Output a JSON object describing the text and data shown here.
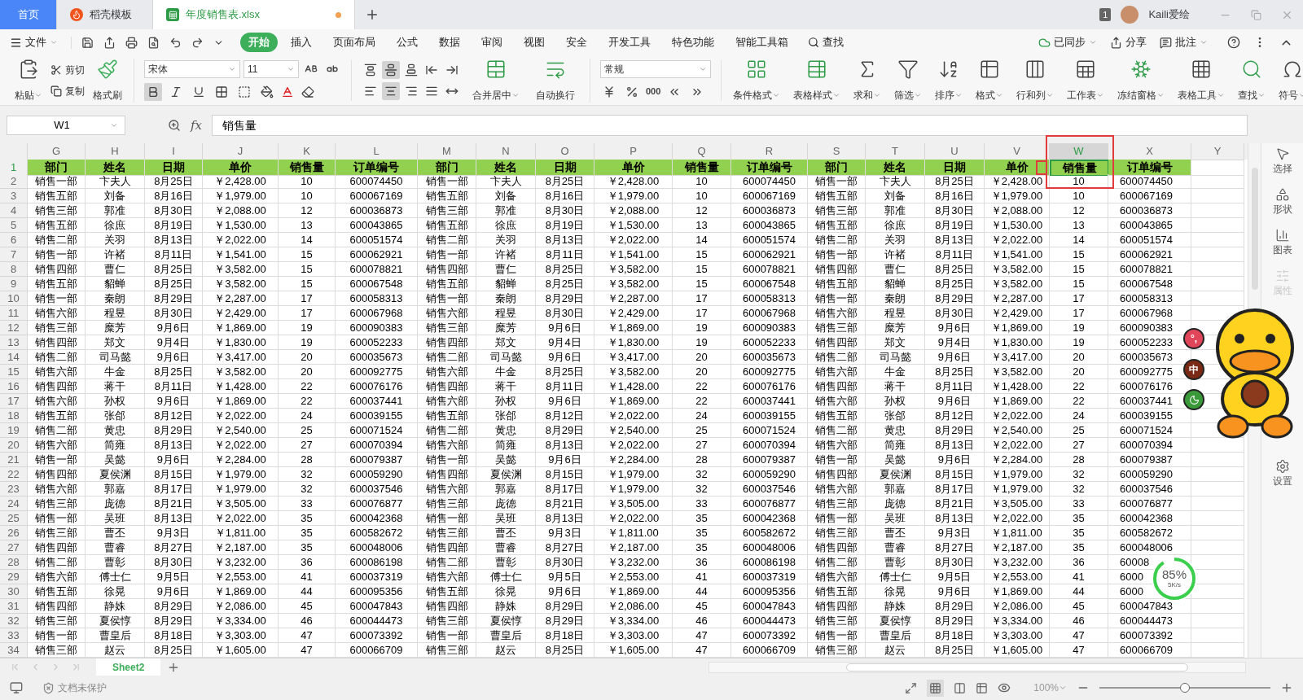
{
  "tabs": [
    {
      "label": "首页",
      "selected": false,
      "kind": "home"
    },
    {
      "label": "稻壳模板",
      "selected": false,
      "kind": "docer"
    },
    {
      "label": "年度销售表.xlsx",
      "selected": true,
      "kind": "sheet",
      "unsaved": true
    }
  ],
  "account": {
    "badge": "1",
    "user": "Kaili爱绘"
  },
  "menu": {
    "file": "文件",
    "tabs": [
      {
        "label": "开始",
        "selected": true
      },
      {
        "label": "插入",
        "selected": false
      },
      {
        "label": "页面布局",
        "selected": false
      },
      {
        "label": "公式",
        "selected": false
      },
      {
        "label": "数据",
        "selected": false
      },
      {
        "label": "审阅",
        "selected": false
      },
      {
        "label": "视图",
        "selected": false
      },
      {
        "label": "安全",
        "selected": false
      },
      {
        "label": "开发工具",
        "selected": false
      },
      {
        "label": "特色功能",
        "selected": false
      },
      {
        "label": "智能工具箱",
        "selected": false
      }
    ],
    "search": "查找",
    "actions": [
      "已同步",
      "分享",
      "批注"
    ]
  },
  "ribbon": {
    "clipboard": [
      "粘贴",
      "剪切",
      "复制",
      "格式刷"
    ],
    "font": {
      "name": "宋体",
      "size": "11",
      "styles": [
        {
          "selected": true
        },
        {
          "selected": false
        },
        {
          "selected": false
        }
      ]
    },
    "align_top": [
      {
        "selected": false
      },
      {
        "selected": true
      },
      {
        "selected": false
      },
      {
        "selected": false
      },
      {
        "selected": false
      }
    ],
    "align_bottom": [
      {
        "selected": false
      },
      {
        "selected": true
      },
      {
        "selected": false
      },
      {
        "selected": false
      },
      {
        "selected": false
      }
    ],
    "merge": [
      "合并居中",
      "自动换行"
    ],
    "number": {
      "format": "常规",
      "thousands": "000"
    },
    "tools": [
      "条件格式",
      "表格样式",
      "求和",
      "筛选",
      "排序",
      "格式",
      "行和列",
      "工作表",
      "冻结窗格",
      "表格工具",
      "查找",
      "符号"
    ]
  },
  "formula_bar": {
    "cell": "W1",
    "fx": "fx",
    "value": "销售量"
  },
  "columns": [
    {
      "label": "G",
      "selected": false
    },
    {
      "label": "H",
      "selected": false
    },
    {
      "label": "I",
      "selected": false
    },
    {
      "label": "J",
      "selected": false
    },
    {
      "label": "K",
      "selected": false
    },
    {
      "label": "L",
      "selected": false
    },
    {
      "label": "M",
      "selected": false
    },
    {
      "label": "N",
      "selected": false
    },
    {
      "label": "O",
      "selected": false
    },
    {
      "label": "P",
      "selected": false
    },
    {
      "label": "Q",
      "selected": false
    },
    {
      "label": "R",
      "selected": false
    },
    {
      "label": "S",
      "selected": false
    },
    {
      "label": "T",
      "selected": false
    },
    {
      "label": "U",
      "selected": false
    },
    {
      "label": "V",
      "selected": false
    },
    {
      "label": "W",
      "selected": true
    },
    {
      "label": "X",
      "selected": false
    },
    {
      "label": "Y",
      "selected": false
    }
  ],
  "rows": [
    {
      "number": "1",
      "kind": "header",
      "selected": true,
      "cells": [
        "部门",
        "姓名",
        "日期",
        "单价",
        "销售量",
        "订单编号",
        "部门",
        "姓名",
        "日期",
        "单价",
        "销售量",
        "订单编号",
        "部门",
        "姓名",
        "日期",
        "单价",
        "销售量",
        "订单编号"
      ]
    },
    {
      "number": "2",
      "kind": "data",
      "selected": false,
      "cells": [
        "销售一部",
        "卞夫人",
        "8月25日",
        "￥2,428.00",
        "10",
        "600074450",
        "销售一部",
        "卞夫人",
        "8月25日",
        "￥2,428.00",
        "10",
        "600074450",
        "销售一部",
        "卞夫人",
        "8月25日",
        "￥2,428.00",
        "10",
        "600074450"
      ]
    },
    {
      "number": "3",
      "kind": "data",
      "selected": false,
      "cells": [
        "销售五部",
        "刘备",
        "8月16日",
        "￥1,979.00",
        "10",
        "600067169",
        "销售五部",
        "刘备",
        "8月16日",
        "￥1,979.00",
        "10",
        "600067169",
        "销售五部",
        "刘备",
        "8月16日",
        "￥1,979.00",
        "10",
        "600067169"
      ]
    },
    {
      "number": "4",
      "kind": "data",
      "selected": false,
      "cells": [
        "销售三部",
        "郭准",
        "8月30日",
        "￥2,088.00",
        "12",
        "600036873",
        "销售三部",
        "郭准",
        "8月30日",
        "￥2,088.00",
        "12",
        "600036873",
        "销售三部",
        "郭准",
        "8月30日",
        "￥2,088.00",
        "12",
        "600036873"
      ]
    },
    {
      "number": "5",
      "kind": "data",
      "selected": false,
      "cells": [
        "销售五部",
        "徐庶",
        "8月19日",
        "￥1,530.00",
        "13",
        "600043865",
        "销售五部",
        "徐庶",
        "8月19日",
        "￥1,530.00",
        "13",
        "600043865",
        "销售五部",
        "徐庶",
        "8月19日",
        "￥1,530.00",
        "13",
        "600043865"
      ]
    },
    {
      "number": "6",
      "kind": "data",
      "selected": false,
      "cells": [
        "销售二部",
        "关羽",
        "8月13日",
        "￥2,022.00",
        "14",
        "600051574",
        "销售二部",
        "关羽",
        "8月13日",
        "￥2,022.00",
        "14",
        "600051574",
        "销售二部",
        "关羽",
        "8月13日",
        "￥2,022.00",
        "14",
        "600051574"
      ]
    },
    {
      "number": "7",
      "kind": "data",
      "selected": false,
      "cells": [
        "销售一部",
        "许褚",
        "8月11日",
        "￥1,541.00",
        "15",
        "600062921",
        "销售一部",
        "许褚",
        "8月11日",
        "￥1,541.00",
        "15",
        "600062921",
        "销售一部",
        "许褚",
        "8月11日",
        "￥1,541.00",
        "15",
        "600062921"
      ]
    },
    {
      "number": "8",
      "kind": "data",
      "selected": false,
      "cells": [
        "销售四部",
        "曹仁",
        "8月25日",
        "￥3,582.00",
        "15",
        "600078821",
        "销售四部",
        "曹仁",
        "8月25日",
        "￥3,582.00",
        "15",
        "600078821",
        "销售四部",
        "曹仁",
        "8月25日",
        "￥3,582.00",
        "15",
        "600078821"
      ]
    },
    {
      "number": "9",
      "kind": "data",
      "selected": false,
      "cells": [
        "销售五部",
        "貂蝉",
        "8月25日",
        "￥3,582.00",
        "15",
        "600067548",
        "销售五部",
        "貂蝉",
        "8月25日",
        "￥3,582.00",
        "15",
        "600067548",
        "销售五部",
        "貂蝉",
        "8月25日",
        "￥3,582.00",
        "15",
        "600067548"
      ]
    },
    {
      "number": "10",
      "kind": "data",
      "selected": false,
      "cells": [
        "销售一部",
        "秦朗",
        "8月29日",
        "￥2,287.00",
        "17",
        "600058313",
        "销售一部",
        "秦朗",
        "8月29日",
        "￥2,287.00",
        "17",
        "600058313",
        "销售一部",
        "秦朗",
        "8月29日",
        "￥2,287.00",
        "17",
        "600058313"
      ]
    },
    {
      "number": "11",
      "kind": "data",
      "selected": false,
      "cells": [
        "销售六部",
        "程昱",
        "8月30日",
        "￥2,429.00",
        "17",
        "600067968",
        "销售六部",
        "程昱",
        "8月30日",
        "￥2,429.00",
        "17",
        "600067968",
        "销售六部",
        "程昱",
        "8月30日",
        "￥2,429.00",
        "17",
        "600067968"
      ]
    },
    {
      "number": "12",
      "kind": "data",
      "selected": false,
      "cells": [
        "销售三部",
        "糜芳",
        "9月6日",
        "￥1,869.00",
        "19",
        "600090383",
        "销售三部",
        "糜芳",
        "9月6日",
        "￥1,869.00",
        "19",
        "600090383",
        "销售三部",
        "糜芳",
        "9月6日",
        "￥1,869.00",
        "19",
        "600090383"
      ]
    },
    {
      "number": "13",
      "kind": "data",
      "selected": false,
      "cells": [
        "销售四部",
        "郑文",
        "9月4日",
        "￥1,830.00",
        "19",
        "600052233",
        "销售四部",
        "郑文",
        "9月4日",
        "￥1,830.00",
        "19",
        "600052233",
        "销售四部",
        "郑文",
        "9月4日",
        "￥1,830.00",
        "19",
        "600052233"
      ]
    },
    {
      "number": "14",
      "kind": "data",
      "selected": false,
      "cells": [
        "销售二部",
        "司马懿",
        "9月6日",
        "￥3,417.00",
        "20",
        "600035673",
        "销售二部",
        "司马懿",
        "9月6日",
        "￥3,417.00",
        "20",
        "600035673",
        "销售二部",
        "司马懿",
        "9月6日",
        "￥3,417.00",
        "20",
        "600035673"
      ]
    },
    {
      "number": "15",
      "kind": "data",
      "selected": false,
      "cells": [
        "销售六部",
        "牛金",
        "8月25日",
        "￥3,582.00",
        "20",
        "600092775",
        "销售六部",
        "牛金",
        "8月25日",
        "￥3,582.00",
        "20",
        "600092775",
        "销售六部",
        "牛金",
        "8月25日",
        "￥3,582.00",
        "20",
        "600092775"
      ]
    },
    {
      "number": "16",
      "kind": "data",
      "selected": false,
      "cells": [
        "销售四部",
        "蒋干",
        "8月11日",
        "￥1,428.00",
        "22",
        "600076176",
        "销售四部",
        "蒋干",
        "8月11日",
        "￥1,428.00",
        "22",
        "600076176",
        "销售四部",
        "蒋干",
        "8月11日",
        "￥1,428.00",
        "22",
        "600076176"
      ]
    },
    {
      "number": "17",
      "kind": "data",
      "selected": false,
      "cells": [
        "销售六部",
        "孙权",
        "9月6日",
        "￥1,869.00",
        "22",
        "600037441",
        "销售六部",
        "孙权",
        "9月6日",
        "￥1,869.00",
        "22",
        "600037441",
        "销售六部",
        "孙权",
        "9月6日",
        "￥1,869.00",
        "22",
        "600037441"
      ]
    },
    {
      "number": "18",
      "kind": "data",
      "selected": false,
      "cells": [
        "销售五部",
        "张郃",
        "8月12日",
        "￥2,022.00",
        "24",
        "600039155",
        "销售五部",
        "张郃",
        "8月12日",
        "￥2,022.00",
        "24",
        "600039155",
        "销售五部",
        "张郃",
        "8月12日",
        "￥2,022.00",
        "24",
        "600039155"
      ]
    },
    {
      "number": "19",
      "kind": "data",
      "selected": false,
      "cells": [
        "销售二部",
        "黄忠",
        "8月29日",
        "￥2,540.00",
        "25",
        "600071524",
        "销售二部",
        "黄忠",
        "8月29日",
        "￥2,540.00",
        "25",
        "600071524",
        "销售二部",
        "黄忠",
        "8月29日",
        "￥2,540.00",
        "25",
        "600071524"
      ]
    },
    {
      "number": "20",
      "kind": "data",
      "selected": false,
      "cells": [
        "销售六部",
        "简雍",
        "8月13日",
        "￥2,022.00",
        "27",
        "600070394",
        "销售六部",
        "简雍",
        "8月13日",
        "￥2,022.00",
        "27",
        "600070394",
        "销售六部",
        "简雍",
        "8月13日",
        "￥2,022.00",
        "27",
        "600070394"
      ]
    },
    {
      "number": "21",
      "kind": "data",
      "selected": false,
      "cells": [
        "销售一部",
        "吴懿",
        "9月6日",
        "￥2,284.00",
        "28",
        "600079387",
        "销售一部",
        "吴懿",
        "9月6日",
        "￥2,284.00",
        "28",
        "600079387",
        "销售一部",
        "吴懿",
        "9月6日",
        "￥2,284.00",
        "28",
        "600079387"
      ]
    },
    {
      "number": "22",
      "kind": "data",
      "selected": false,
      "cells": [
        "销售四部",
        "夏侯渊",
        "8月15日",
        "￥1,979.00",
        "32",
        "600059290",
        "销售四部",
        "夏侯渊",
        "8月15日",
        "￥1,979.00",
        "32",
        "600059290",
        "销售四部",
        "夏侯渊",
        "8月15日",
        "￥1,979.00",
        "32",
        "600059290"
      ]
    },
    {
      "number": "23",
      "kind": "data",
      "selected": false,
      "cells": [
        "销售六部",
        "郭嘉",
        "8月17日",
        "￥1,979.00",
        "32",
        "600037546",
        "销售六部",
        "郭嘉",
        "8月17日",
        "￥1,979.00",
        "32",
        "600037546",
        "销售六部",
        "郭嘉",
        "8月17日",
        "￥1,979.00",
        "32",
        "600037546"
      ]
    },
    {
      "number": "24",
      "kind": "data",
      "selected": false,
      "cells": [
        "销售三部",
        "庞德",
        "8月21日",
        "￥3,505.00",
        "33",
        "600076877",
        "销售三部",
        "庞德",
        "8月21日",
        "￥3,505.00",
        "33",
        "600076877",
        "销售三部",
        "庞德",
        "8月21日",
        "￥3,505.00",
        "33",
        "600076877"
      ]
    },
    {
      "number": "25",
      "kind": "data",
      "selected": false,
      "cells": [
        "销售一部",
        "吴班",
        "8月13日",
        "￥2,022.00",
        "35",
        "600042368",
        "销售一部",
        "吴班",
        "8月13日",
        "￥2,022.00",
        "35",
        "600042368",
        "销售一部",
        "吴班",
        "8月13日",
        "￥2,022.00",
        "35",
        "600042368"
      ]
    },
    {
      "number": "26",
      "kind": "data",
      "selected": false,
      "cells": [
        "销售三部",
        "曹丕",
        "9月3日",
        "￥1,811.00",
        "35",
        "600582672",
        "销售三部",
        "曹丕",
        "9月3日",
        "￥1,811.00",
        "35",
        "600582672",
        "销售三部",
        "曹丕",
        "9月3日",
        "￥1,811.00",
        "35",
        "600582672"
      ]
    },
    {
      "number": "27",
      "kind": "data",
      "selected": false,
      "cells": [
        "销售四部",
        "曹睿",
        "8月27日",
        "￥2,187.00",
        "35",
        "600048006",
        "销售四部",
        "曹睿",
        "8月27日",
        "￥2,187.00",
        "35",
        "600048006",
        "销售四部",
        "曹睿",
        "8月27日",
        "￥2,187.00",
        "35",
        "600048006"
      ]
    },
    {
      "number": "28",
      "kind": "data",
      "selected": false,
      "cells": [
        "销售二部",
        "曹彰",
        "8月30日",
        "￥3,232.00",
        "36",
        "600086198",
        "销售二部",
        "曹彰",
        "8月30日",
        "￥3,232.00",
        "36",
        "600086198",
        "销售二部",
        "曹彰",
        "8月30日",
        "￥3,232.00",
        "36",
        "60008"
      ]
    },
    {
      "number": "29",
      "kind": "data",
      "selected": false,
      "cells": [
        "销售六部",
        "傅士仁",
        "9月5日",
        "￥2,553.00",
        "41",
        "600037319",
        "销售六部",
        "傅士仁",
        "9月5日",
        "￥2,553.00",
        "41",
        "600037319",
        "销售六部",
        "傅士仁",
        "9月5日",
        "￥2,553.00",
        "41",
        "6000"
      ]
    },
    {
      "number": "30",
      "kind": "data",
      "selected": false,
      "cells": [
        "销售五部",
        "徐晃",
        "9月6日",
        "￥1,869.00",
        "44",
        "600095356",
        "销售五部",
        "徐晃",
        "9月6日",
        "￥1,869.00",
        "44",
        "600095356",
        "销售五部",
        "徐晃",
        "9月6日",
        "￥1,869.00",
        "44",
        "6000"
      ]
    },
    {
      "number": "31",
      "kind": "data",
      "selected": false,
      "cells": [
        "销售四部",
        "静姝",
        "8月29日",
        "￥2,086.00",
        "45",
        "600047843",
        "销售四部",
        "静姝",
        "8月29日",
        "￥2,086.00",
        "45",
        "600047843",
        "销售四部",
        "静姝",
        "8月29日",
        "￥2,086.00",
        "45",
        "600047843"
      ]
    },
    {
      "number": "32",
      "kind": "data",
      "selected": false,
      "cells": [
        "销售三部",
        "夏侯惇",
        "8月29日",
        "￥3,334.00",
        "46",
        "600044473",
        "销售三部",
        "夏侯惇",
        "8月29日",
        "￥3,334.00",
        "46",
        "600044473",
        "销售三部",
        "夏侯惇",
        "8月29日",
        "￥3,334.00",
        "46",
        "600044473"
      ]
    },
    {
      "number": "33",
      "kind": "data",
      "selected": false,
      "cells": [
        "销售一部",
        "曹皇后",
        "8月18日",
        "￥3,303.00",
        "47",
        "600073392",
        "销售一部",
        "曹皇后",
        "8月18日",
        "￥3,303.00",
        "47",
        "600073392",
        "销售一部",
        "曹皇后",
        "8月18日",
        "￥3,303.00",
        "47",
        "600073392"
      ]
    },
    {
      "number": "34",
      "kind": "data",
      "selected": false,
      "cells": [
        "销售三部",
        "赵云",
        "8月25日",
        "￥1,605.00",
        "47",
        "600066709",
        "销售三部",
        "赵云",
        "8月25日",
        "￥1,605.00",
        "47",
        "600066709",
        "销售三部",
        "赵云",
        "8月25日",
        "￥1,605.00",
        "47",
        "600066709"
      ]
    }
  ],
  "side_panel": [
    {
      "label": "选择",
      "disabled": false
    },
    {
      "label": "形状",
      "disabled": false
    },
    {
      "label": "图表",
      "disabled": false
    },
    {
      "label": "属性",
      "disabled": true
    },
    {
      "label": "设置",
      "disabled": false
    }
  ],
  "sheets": [
    {
      "label": "Sheet2",
      "selected": true
    }
  ],
  "status_bar": {
    "protection": "文档未保护",
    "zoom": "100%",
    "zoom_level": {
      "level": 0.5
    }
  },
  "ime_toolbar": [
    "°,",
    "中"
  ],
  "net_meter": {
    "percent": "85%",
    "speed": "5K/s"
  }
}
